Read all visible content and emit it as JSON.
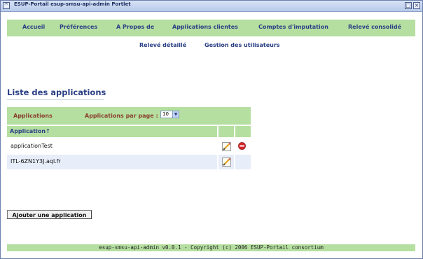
{
  "window": {
    "title": "ESUP-Portail esup-smsu-api-admin Portlet"
  },
  "menu": {
    "items": [
      {
        "label": "Accueil"
      },
      {
        "label": "Préférences"
      },
      {
        "label": "A Propos de"
      },
      {
        "label": "Applications clientes"
      },
      {
        "label": "Comptes d'imputation"
      },
      {
        "label": "Relevé consolidé"
      }
    ],
    "subitems": [
      {
        "label": "Relevé détaillé"
      },
      {
        "label": "Gestion des utilisateurs"
      }
    ]
  },
  "section": {
    "title": "Liste des applications"
  },
  "table": {
    "header_label": "Applications",
    "per_page_label": "Applications par page :",
    "per_page_value": "10",
    "column_header": "Application↑",
    "rows": [
      {
        "name": "applicationTest",
        "editable": true,
        "deletable": true
      },
      {
        "name": "ITL-6ZN1Y3J.aql.fr",
        "editable": true,
        "deletable": false
      }
    ]
  },
  "actions": {
    "add_label": "Ajouter une application"
  },
  "footer": {
    "text": "esup-smsu-api-admin v0.0.1 - Copyright (c) 2006 ESUP-Portail consortium"
  },
  "colors": {
    "accent_green": "#b5dfa0",
    "link_blue": "#2a3f85",
    "header_red": "#8a3e2e",
    "row_alt": "#e7eef9"
  }
}
